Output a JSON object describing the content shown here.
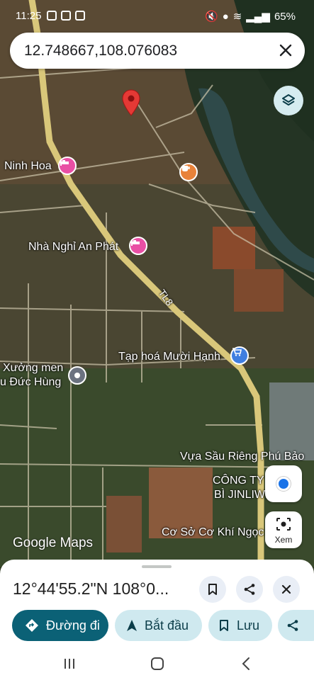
{
  "status": {
    "time": "11:25",
    "battery": "65%"
  },
  "search": {
    "query": "12.748667,108.076083"
  },
  "map": {
    "labels": {
      "ninh_hoa": "Ninh Hoa",
      "nha_nghi": "Nhà Nghỉ An Phát",
      "road": "TL8",
      "tap_hoa": "Tạp hoá Mười Hạnh",
      "xuong_men_1": "Xưởng men",
      "xuong_men_2": "u Đức Hùng",
      "vua_sau_rieng": "Vựa Sầu Riêng Phú Bảo",
      "cong_ty_1": "CÔNG TY",
      "cong_ty_2": "BÌ JINLIWE",
      "co_so": "Cơ Sở Cơ Khí Ngọc"
    },
    "google_logo": "Google Maps",
    "lens_label": "Xem"
  },
  "sheet": {
    "title": "12°44'55.2\"N 108°0...",
    "actions": {
      "directions": "Đường đi",
      "start": "Bắt đầu",
      "save": "Lưu"
    }
  },
  "colors": {
    "accent": "#0b6176",
    "pin": "#e53935",
    "road": "#d9c77a"
  }
}
